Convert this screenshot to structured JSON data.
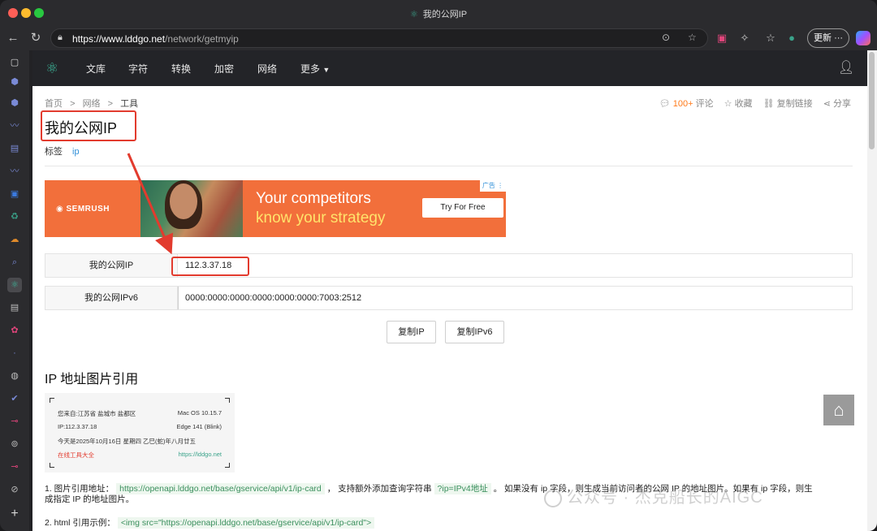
{
  "window": {
    "title": "我的公网IP"
  },
  "browser": {
    "url_host": "https://www.lddgo.net",
    "url_path": "/network/getmyip",
    "update_label": "更新"
  },
  "sitenav": {
    "items": [
      "文库",
      "字符",
      "转换",
      "加密",
      "网络",
      "更多"
    ]
  },
  "breadcrumb": {
    "home": "首页",
    "sep": ">",
    "network": "网络",
    "tools": "工具"
  },
  "actions": {
    "comments_count": "100+",
    "comments_label": "评论",
    "favorite_label": "收藏",
    "copy_link_label": "复制链接",
    "share_label": "分享"
  },
  "page": {
    "title": "我的公网IP",
    "tags_label": "标签",
    "tag": "ip"
  },
  "ad": {
    "brand": "SEMRUSH",
    "line1": "Your competitors",
    "line2": "know your strategy",
    "cta": "Try For Free",
    "ad_tag": "广告"
  },
  "ip": {
    "ipv4_label": "我的公网IP",
    "ipv4_value": "112.3.37.18",
    "ipv6_label": "我的公网IPv6",
    "ipv6_value": "0000:0000:0000:0000:0000:0000:7003:2512",
    "copy_ip_label": "复制IP",
    "copy_ipv6_label": "复制IPv6"
  },
  "section2": {
    "title": "IP 地址图片引用",
    "card": {
      "from": "您来自:江苏省 盐城市 盐都区",
      "os": "Mac OS 10.15.7",
      "ip": "IP:112.3.37.18",
      "browser": "Edge 141 (Blink)",
      "date": "今天是2025年10月16日 星期四 乙巳(蛇)年八月廿五",
      "site_name": "在线工具大全",
      "site_url": "https://lddgo.net"
    },
    "p1_prefix": "1. 图片引用地址：",
    "p1_url": "https://openapi.lddgo.net/base/gservice/api/v1/ip-card",
    "p1_mid": "， 支持额外添加查询字符串",
    "p1_param": "?ip=IPv4地址",
    "p1_suffix": "。 如果没有 ip 字段，则生成当前访问者的公网 IP 的地址图片。如果有 ip 字段，则生",
    "p1_line2": "成指定 IP 的地址图片。",
    "p2_prefix": "2. html 引用示例：",
    "p2_code": "<img src=\"https://openapi.lddgo.net/base/gservice/api/v1/ip-card\">"
  },
  "watermark": "公众号 · 杰克船长的AIGC"
}
